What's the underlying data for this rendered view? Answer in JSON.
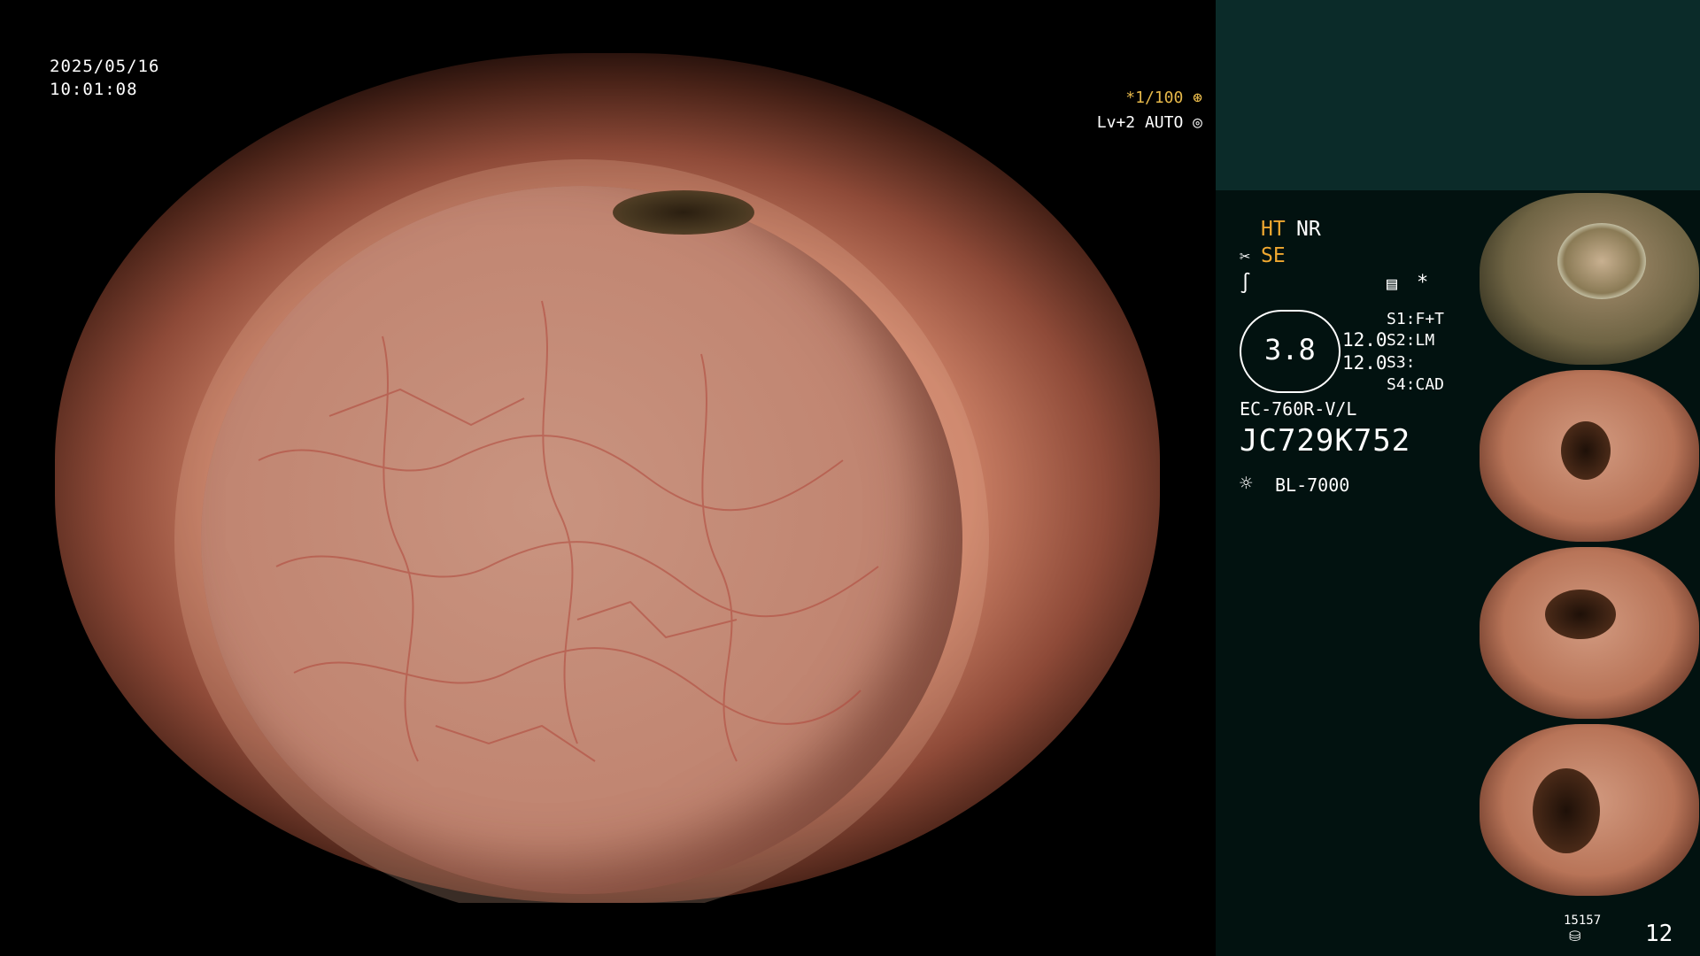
{
  "overlay": {
    "date": "2025/05/16",
    "time": "10:01:08",
    "shutter": "*1/100",
    "iris": "Lv+2 AUTO"
  },
  "panel": {
    "ht": "HT",
    "nr": "NR",
    "se": "SE",
    "star": "*",
    "gauge_value": "3.8",
    "gauge_line1": "12.0",
    "gauge_line2": "12.0",
    "s1": "S1:F+T",
    "s2": "S2:LM",
    "s3": "S3:",
    "s4": "S4:CAD",
    "scope_model": "EC-760R-V/L",
    "serial": "JC729K752",
    "light_source": "BL-7000"
  },
  "footer": {
    "image_counter": "15157",
    "page": "12"
  },
  "icons": [
    "shutter-icon",
    "iris-icon",
    "scissors-icon",
    "edge-icon",
    "screen-icon",
    "light-source-icon",
    "database-icon"
  ]
}
